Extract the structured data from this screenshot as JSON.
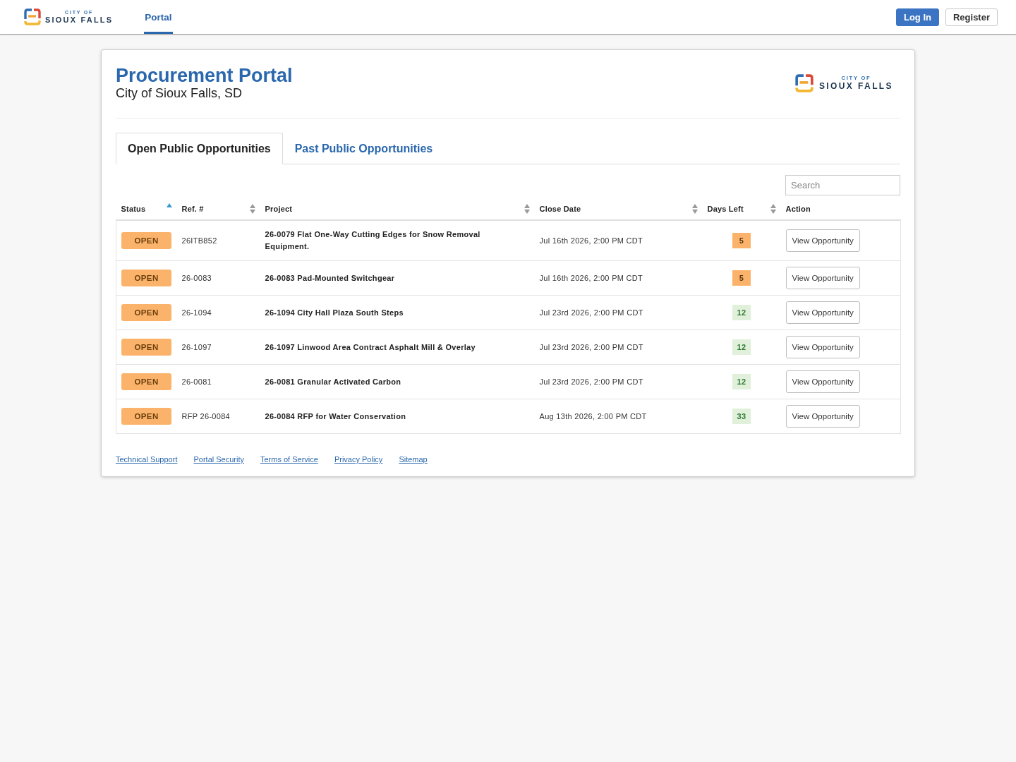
{
  "header": {
    "logo": {
      "line_1": "CITY OF",
      "line_2": "SIOUX FALLS"
    },
    "nav": [
      {
        "label": "Portal",
        "selected": true
      }
    ],
    "buttons": [
      {
        "label": "Log In",
        "kind": "primary"
      },
      {
        "label": "Register",
        "kind": "secondary"
      }
    ]
  },
  "page": {
    "title": "Procurement Portal",
    "subtitle": "City of Sioux Falls, SD",
    "logo": {
      "line_1": "CITY OF",
      "line_2": "SIOUX FALLS"
    }
  },
  "tabs": [
    {
      "label": "Open Public Opportunities",
      "selected": true
    },
    {
      "label": "Past Public Opportunities",
      "selected": false
    }
  ],
  "search": {
    "placeholder": "Search"
  },
  "table": {
    "columns": [
      {
        "label": "Status",
        "kind": "sortable",
        "sorted": true
      },
      {
        "label": "Ref. #",
        "kind": "sortable",
        "sorted": false
      },
      {
        "label": "Project",
        "kind": "sortable",
        "sorted": false
      },
      {
        "label": "Close Date",
        "kind": "sortable",
        "sorted": false
      },
      {
        "label": "Days Left",
        "kind": "sortable",
        "sorted": false
      },
      {
        "label": "Action",
        "kind": "plain"
      }
    ],
    "rows": [
      {
        "status": "OPEN",
        "ref": "26ITB852",
        "project": "26-0079 Flat One-Way Cutting Edges for Snow Removal Equipment.",
        "close_date": "Jul 16th 2026, 2:00 PM CDT",
        "days_left": {
          "text": "5",
          "color": "#fbb36b"
        },
        "action": "View Opportunity"
      },
      {
        "status": "OPEN",
        "ref": "26-0083",
        "project": "26-0083 Pad-Mounted Switchgear",
        "close_date": "Jul 16th 2026, 2:00 PM CDT",
        "days_left": {
          "text": "5",
          "color": "#fbb36b"
        },
        "action": "View Opportunity"
      },
      {
        "status": "OPEN",
        "ref": "26-1094",
        "project": "26-1094 City Hall Plaza South Steps",
        "close_date": "Jul 23rd 2026, 2:00 PM CDT",
        "days_left": {
          "text": "12",
          "color": "#e1f0db"
        },
        "action": "View Opportunity"
      },
      {
        "status": "OPEN",
        "ref": "26-1097",
        "project": "26-1097 Linwood Area Contract Asphalt Mill & Overlay",
        "close_date": "Jul 23rd 2026, 2:00 PM CDT",
        "days_left": {
          "text": "12",
          "color": "#e1f0db"
        },
        "action": "View Opportunity"
      },
      {
        "status": "OPEN",
        "ref": "26-0081",
        "project": "26-0081 Granular Activated Carbon",
        "close_date": "Jul 23rd 2026, 2:00 PM CDT",
        "days_left": {
          "text": "12",
          "color": "#e1f0db"
        },
        "action": "View Opportunity"
      },
      {
        "status": "OPEN",
        "ref": "RFP 26-0084",
        "project": "26-0084 RFP for Water Conservation",
        "close_date": "Aug 13th 2026, 2:00 PM CDT",
        "days_left": {
          "text": "33",
          "color": "#e1f0db"
        },
        "action": "View Opportunity"
      }
    ]
  },
  "footer_links": [
    "Technical Support",
    "Portal Security",
    "Terms of Service",
    "Privacy Policy",
    "Sitemap"
  ]
}
